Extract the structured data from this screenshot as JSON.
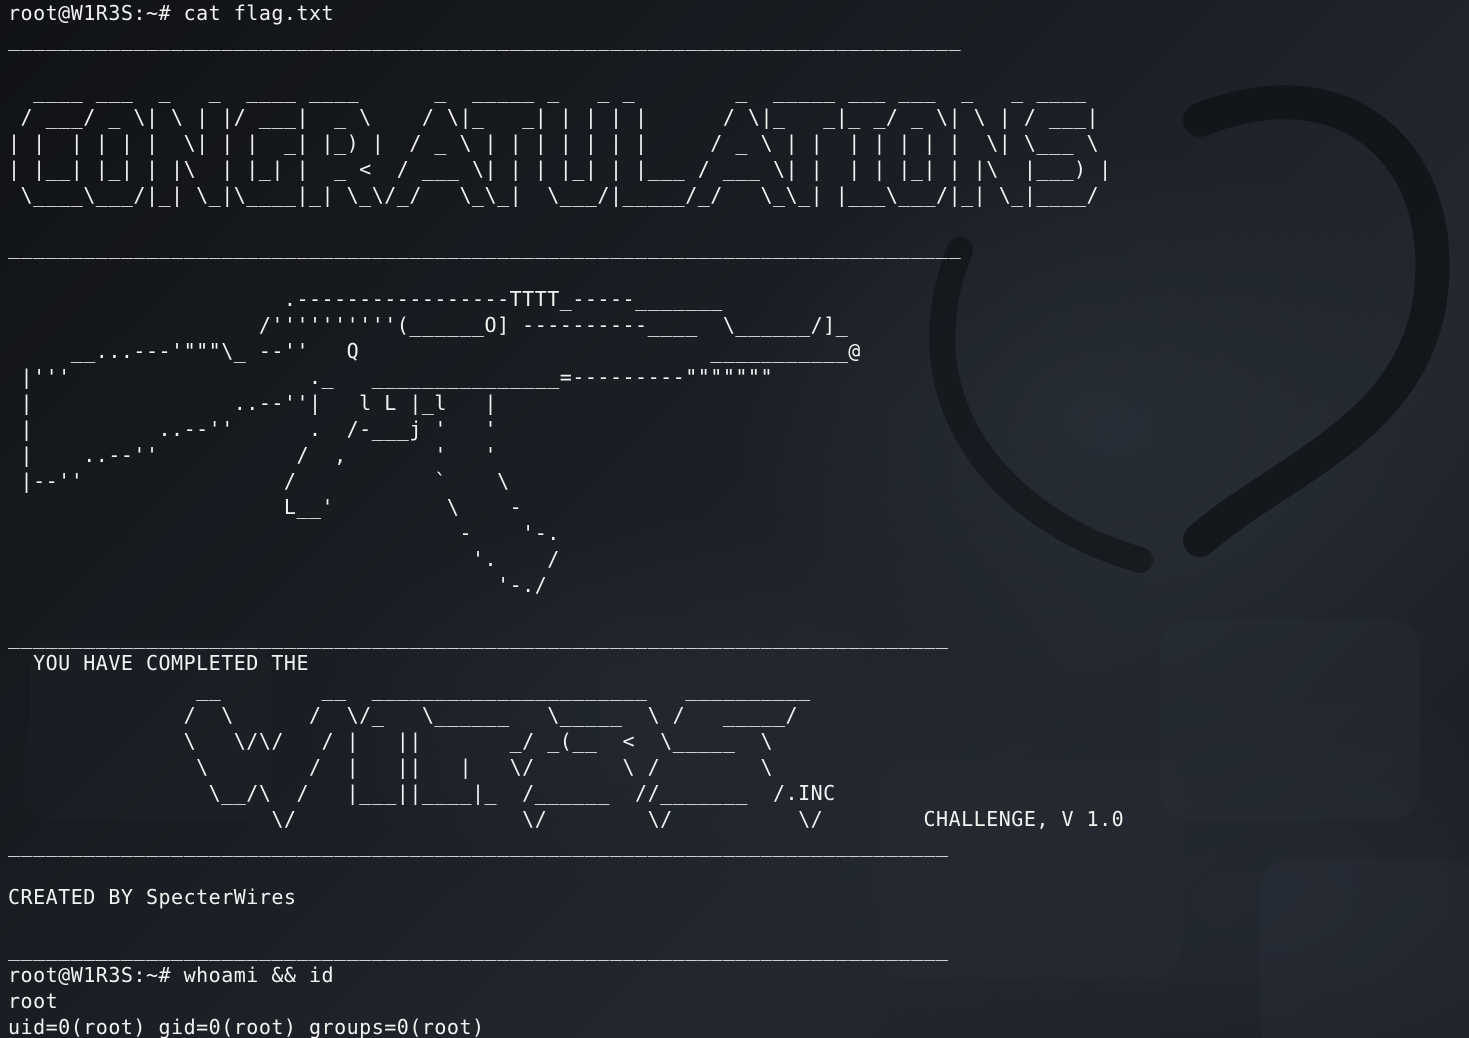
{
  "terminal": {
    "prompt": "root@W1R3S:~# ",
    "command1": "cat flag.txt",
    "divider_long": "____________________________________________________________________________",
    "divider_short": "___________________________________________________________________________",
    "congrats_art": [
      "  ____ ___  _   _  ____ ____      _  _____ _   _ _        _  _____ ___ ___  _   _ ____",
      " / ___/ _ \\| \\ | |/ ___|  _ \\    / \\|_   _| | | | |      / \\|_   _|_ _/ _ \\| \\ | / ___|",
      "| |  | | | |  \\| | |  _| |_) |  / _ \\ | | | | | | |     / _ \\ | |  | | | | |  \\| \\___ \\",
      "| |__| |_| | |\\  | |_| |  _ <  / ___ \\| | | |_| | |___ / ___ \\| |  | | |_| | |\\  |___) |",
      " \\____\\___/|_| \\_|\\____|_| \\_\\/_/   \\_\\_|  \\___/|_____/_/   \\_\\_| |___\\___/|_| \\_|____/"
    ],
    "rifle_art": [
      "                      .-----------------TTTT_-----_______",
      "                    /''''''''''(______O] ----------____  \\______/]_",
      "     __...---'\"\"\"\\_ --''   Q                            ___________@",
      " |'''                   ._   _______________=---------\"\"\"\"\"\"\"",
      " |                ..--''|   l L |_l   |",
      " |          ..--''      .  /-___j '   '",
      " |    ..--''           /  ,       '   '",
      " |--''                /           `    \\",
      "                      L__'         \\    -",
      "                                    -    '-.",
      "                                     '.    /",
      "                                       '-./"
    ],
    "completed_text": "  YOU HAVE COMPLETED THE",
    "wires_art": [
      "               __        __  ______________________   __________",
      "              /  \\      /  \\/_   \\______   \\_____  \\ /   _____/",
      "              \\   \\/\\/   / |   ||       _/ _(__  <  \\_____  \\",
      "               \\        /  |   ||   |   \\/       \\ /        \\",
      "                \\__/\\  /   |___||____|_  /______  //_______  /.INC"
    ],
    "wires_last_line": "                     \\/                  \\/        \\/          \\/",
    "challenge_text": "        CHALLENGE, V 1.0",
    "credit": "CREATED BY SpecterWires",
    "command2": "whoami && id",
    "output_user": "root",
    "output_id": "uid=0(root) gid=0(root) groups=0(root)"
  }
}
